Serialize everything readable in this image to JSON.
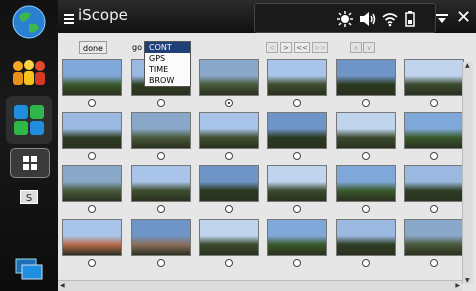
{
  "app": {
    "title": "iScope"
  },
  "toolbar": {
    "done_label": "done",
    "go_label": "go",
    "dropdown_options": [
      "CONT",
      "GPS",
      "TIME",
      "BROW"
    ],
    "dropdown_selected": "CONT",
    "nav_prev": "<",
    "nav_next": ">",
    "nav_first": "<<",
    "nav_last": ">>",
    "nav_up": "∧",
    "nav_down": "∨"
  },
  "thumbnails": [
    "sky with trees",
    "trees and sky",
    "hillside with trees",
    "sky and grass",
    "tree canopy",
    "tree canopy",
    "tree in sky",
    "tree branches",
    "forest view",
    "forest view",
    "bright forest",
    "green pines",
    "tree silhouette",
    "sky with pines",
    "sky and trees",
    "tree canopy",
    "green shrubs",
    "pine trees",
    "building wall",
    "rock slope",
    "trees at dusk",
    "hilltop",
    "trash can",
    "bench and trees"
  ],
  "selected_index": 2,
  "colors": {
    "dropdown_highlight": "#1f3f79",
    "app_bg": "#e6e6e6"
  },
  "icons": [
    "globe-icon",
    "people-icon",
    "apps-icon",
    "grid-icon",
    "s-icon",
    "windows-icon",
    "menu-icon",
    "brightness-icon",
    "volume-icon",
    "wifi-icon",
    "battery-icon",
    "minimize-icon",
    "close-icon"
  ]
}
